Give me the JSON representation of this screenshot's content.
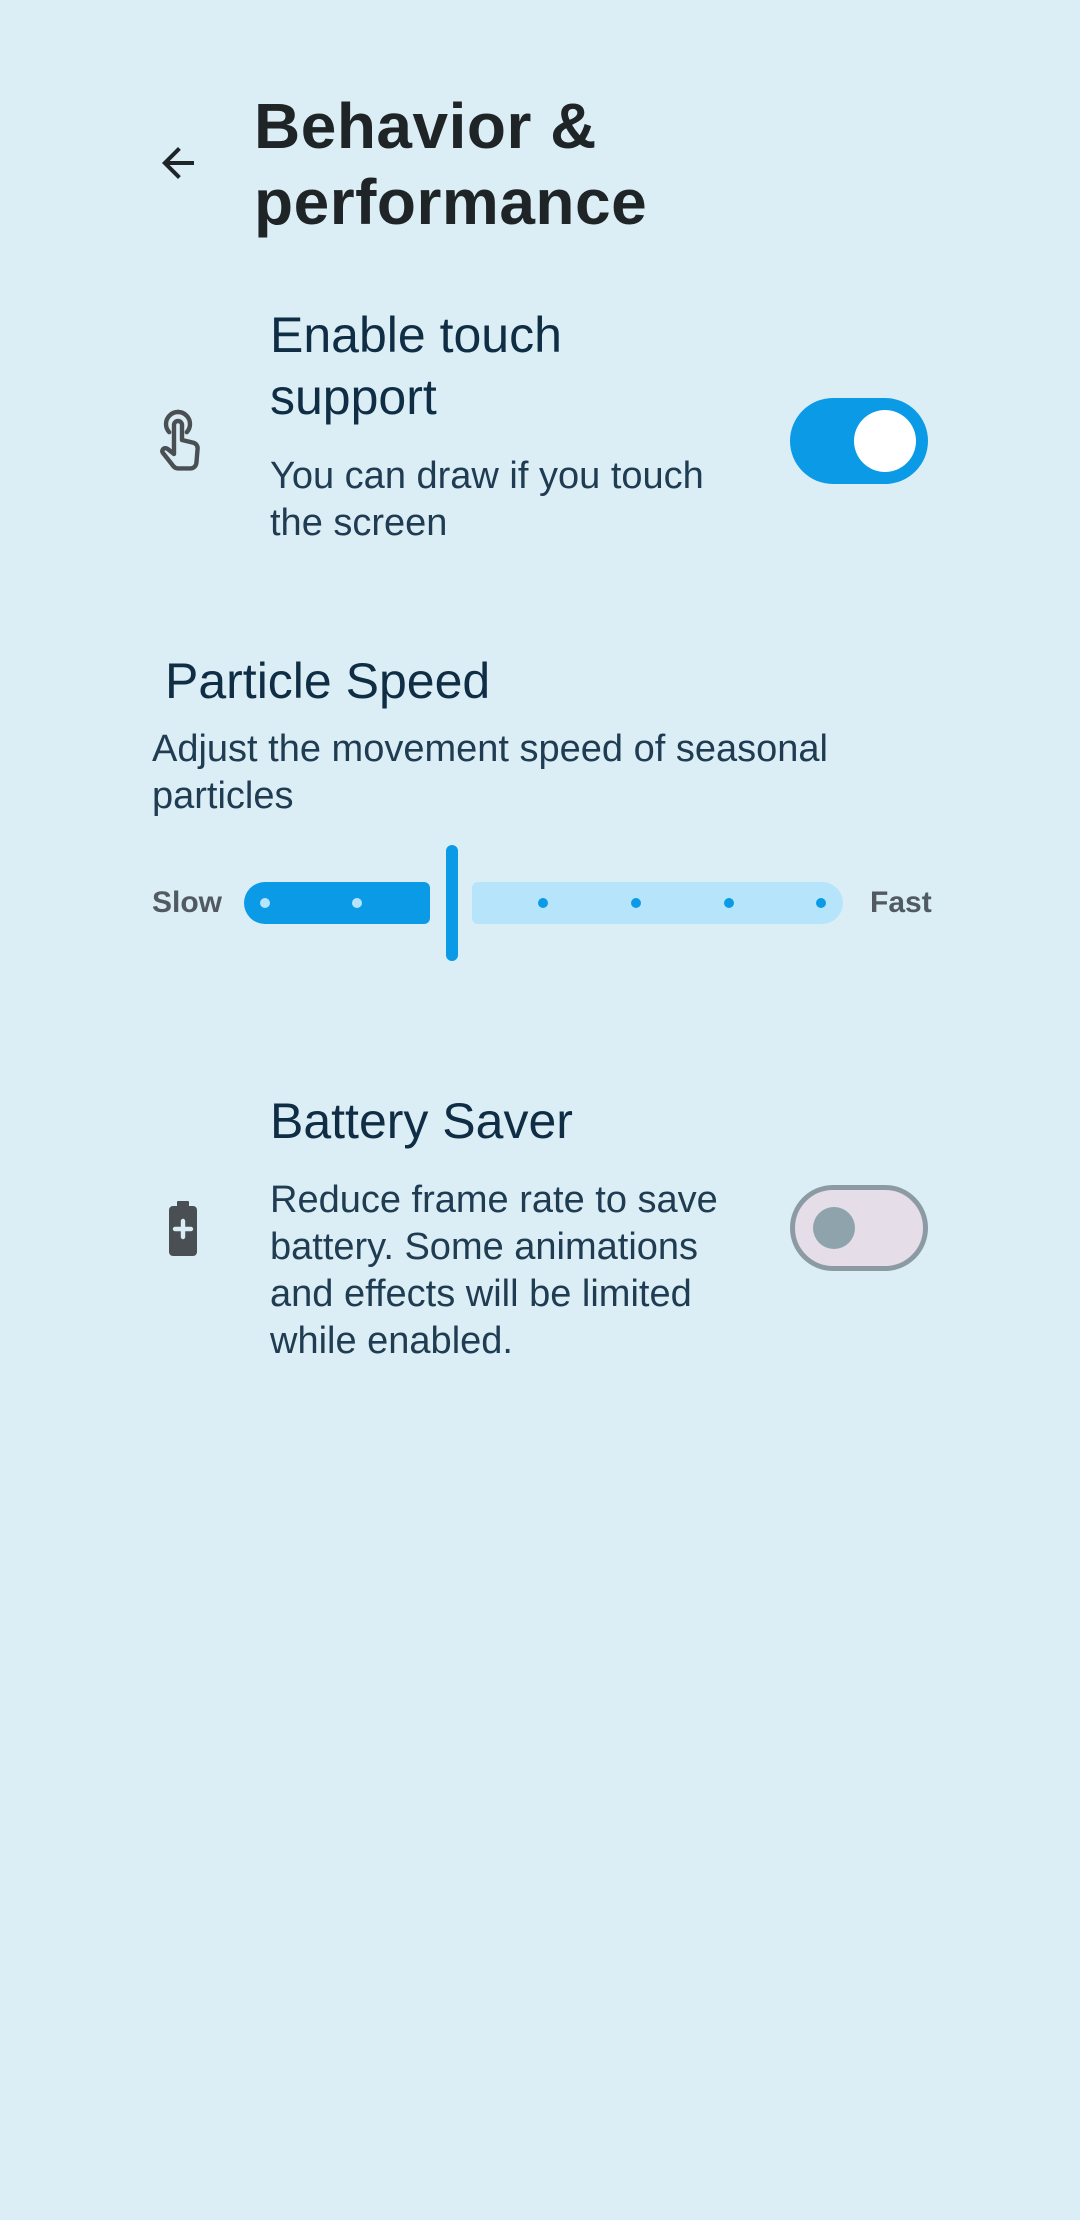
{
  "header": {
    "title_line1": "Behavior &",
    "title_line2": "performance"
  },
  "touch_support": {
    "title_line1": "Enable touch",
    "title_line2": "support",
    "desc_line1": "You can draw if you touch",
    "desc_line2": "the screen",
    "enabled": true
  },
  "particle_speed": {
    "title": "Particle Speed",
    "desc_line1": "Adjust the movement speed of seasonal",
    "desc_line2": "particles",
    "min_label": "Slow",
    "max_label": "Fast",
    "steps": 8,
    "value_step": 2
  },
  "battery_saver": {
    "title": "Battery Saver",
    "desc_line1": "Reduce frame rate to save",
    "desc_line2": "battery. Some animations",
    "desc_line3": "and effects will be limited",
    "desc_line4": "while enabled.",
    "enabled": false
  },
  "colors": {
    "background": "#dbeef5",
    "accent": "#0b9be6",
    "accent_light": "#b6e5fb",
    "title_text": "#1f2427",
    "body_text": "#0f2d44"
  }
}
